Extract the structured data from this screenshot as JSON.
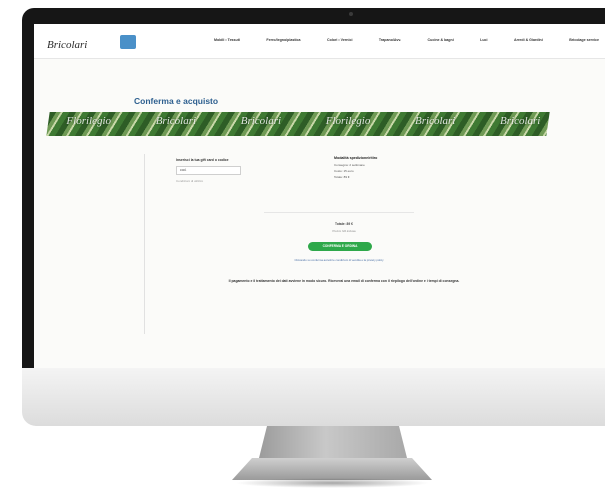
{
  "site": {
    "logo": "Bricolari",
    "nav": [
      "Mobili • Tessuti",
      "Ferro/legno/plastica",
      "Colori • Vernici",
      "Trapano/Avv.",
      "Cucine & bagni",
      "Luci",
      "Arredi & Giardini",
      "Bricolage service"
    ]
  },
  "page": {
    "title": "Conferma e acquisto",
    "banner_words": [
      "Florilegio",
      "Bricolari",
      "Bricolari",
      "Florilegio",
      "Bricolari",
      "Bricolari"
    ]
  },
  "form": {
    "coupon_label": "Inserisci la tua gift card o codice",
    "coupon_value": "cod.",
    "promo_link": "Condizioni di utilizzo"
  },
  "shipping": {
    "title": "Modalità spedizione/ritiro",
    "line1": "Consegna: 2 settimane",
    "line2": "Costo: 15 euro",
    "line3": "Totale: 89 €"
  },
  "summary": {
    "total": "Totale: 89 €",
    "vat": "Prezzo IVA inclusa",
    "button": "CONFERMA E ORDINA",
    "terms": "Cliccando su conferma accetti le condizioni di vendita e la privacy policy"
  },
  "notice": "Il pagamento e il trattamento dei dati avviene in modo sicuro. Riceverai una email di conferma con il riepilogo dell'ordine e i tempi di consegna."
}
